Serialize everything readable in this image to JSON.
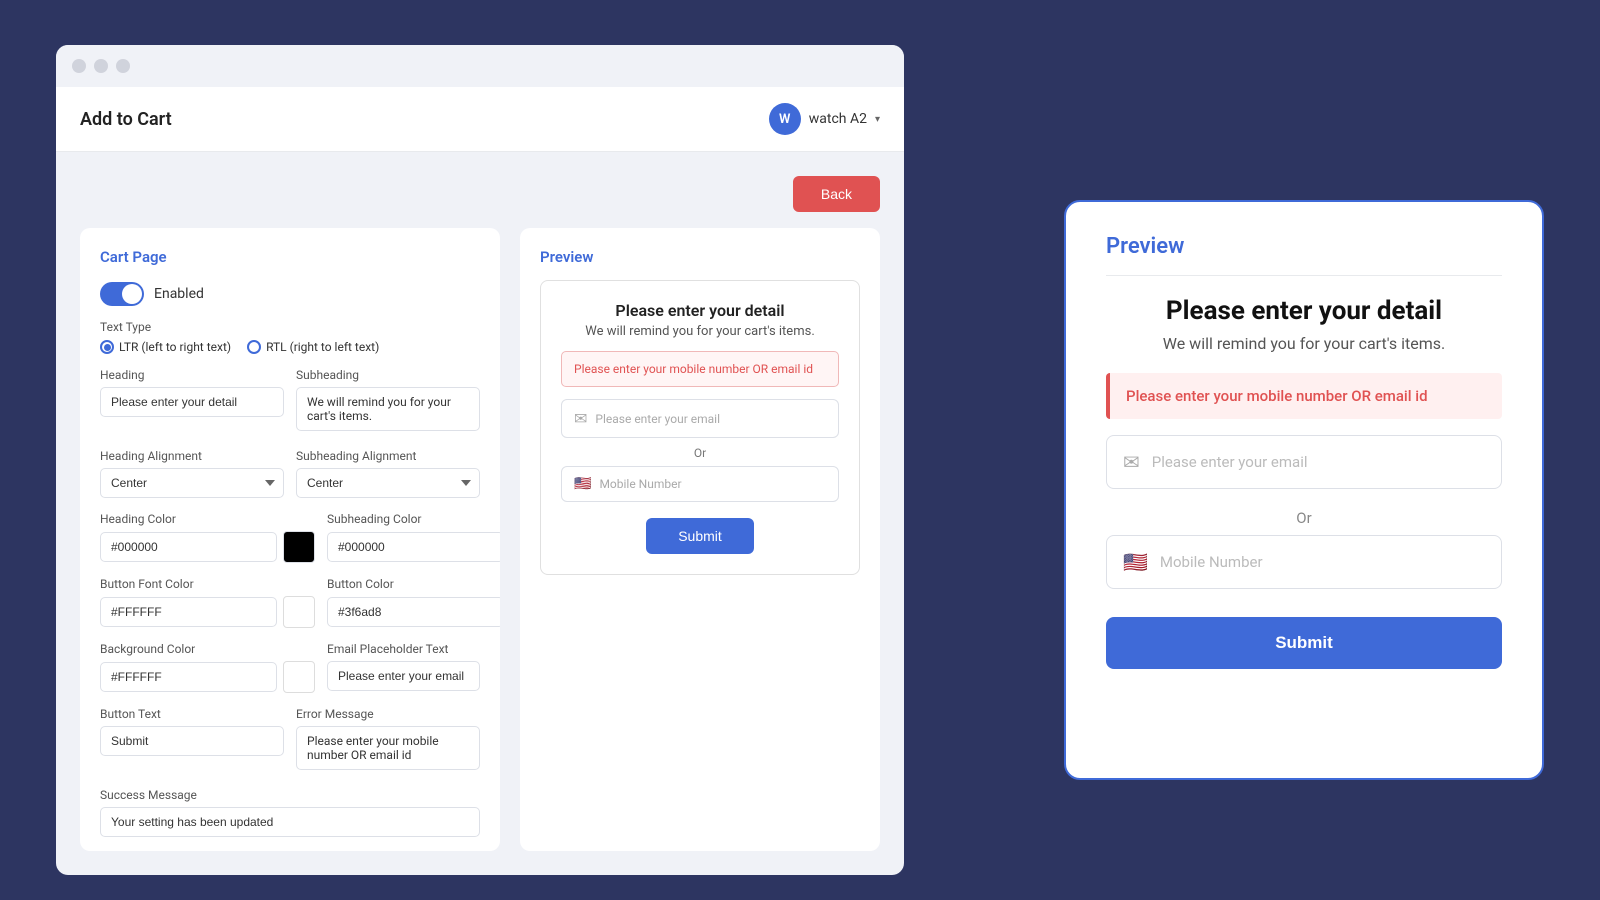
{
  "browser": {
    "dots": [
      "dot1",
      "dot2",
      "dot3"
    ]
  },
  "header": {
    "title": "Add to Cart",
    "user_avatar": "W",
    "user_name": "watch A2"
  },
  "back_button": "Back",
  "left_panel": {
    "title": "Cart Page",
    "toggle_label": "Enabled",
    "text_type_label": "Text Type",
    "ltr_label": "LTR (left to right text)",
    "rtl_label": "RTL (right to left text)",
    "heading_label": "Heading",
    "heading_value": "Please enter your detail",
    "subheading_label": "Subheading",
    "subheading_value": "We will remind you for your cart's items.",
    "heading_alignment_label": "Heading Alignment",
    "heading_alignment_value": "Center",
    "subheading_alignment_label": "Subheading Alignment",
    "subheading_alignment_value": "Center",
    "heading_color_label": "Heading Color",
    "heading_color_value": "#000000",
    "subheading_color_label": "Subheading Color",
    "subheading_color_value": "#000000",
    "button_font_color_label": "Button Font Color",
    "button_font_color_value": "#FFFFFF",
    "button_color_label": "Button Color",
    "button_color_value": "#3f6ad8",
    "bg_color_label": "Background Color",
    "bg_color_value": "#FFFFFF",
    "email_placeholder_label": "Email Placeholder Text",
    "email_placeholder_value": "Please enter your email",
    "button_text_label": "Button Text",
    "button_text_value": "Submit",
    "error_message_label": "Error Message",
    "error_message_value": "Please enter your mobile number OR email id",
    "success_message_label": "Success Message",
    "success_message_value": "Your setting has been updated"
  },
  "small_preview": {
    "title": "Preview",
    "heading": "Please enter your detail",
    "subheading": "We will remind you for your cart's items.",
    "error": "Please enter your mobile number OR email id",
    "email_placeholder": "Please enter your email",
    "or_text": "Or",
    "mobile_placeholder": "Mobile Number",
    "submit_label": "Submit"
  },
  "large_preview": {
    "title": "Preview",
    "heading": "Please enter your detail",
    "subheading": "We will remind you for your cart's items.",
    "error": "Please enter your mobile number OR email id",
    "email_placeholder": "Please enter your email",
    "or_text": "Or",
    "mobile_placeholder": "Mobile Number",
    "submit_label": "Submit"
  }
}
